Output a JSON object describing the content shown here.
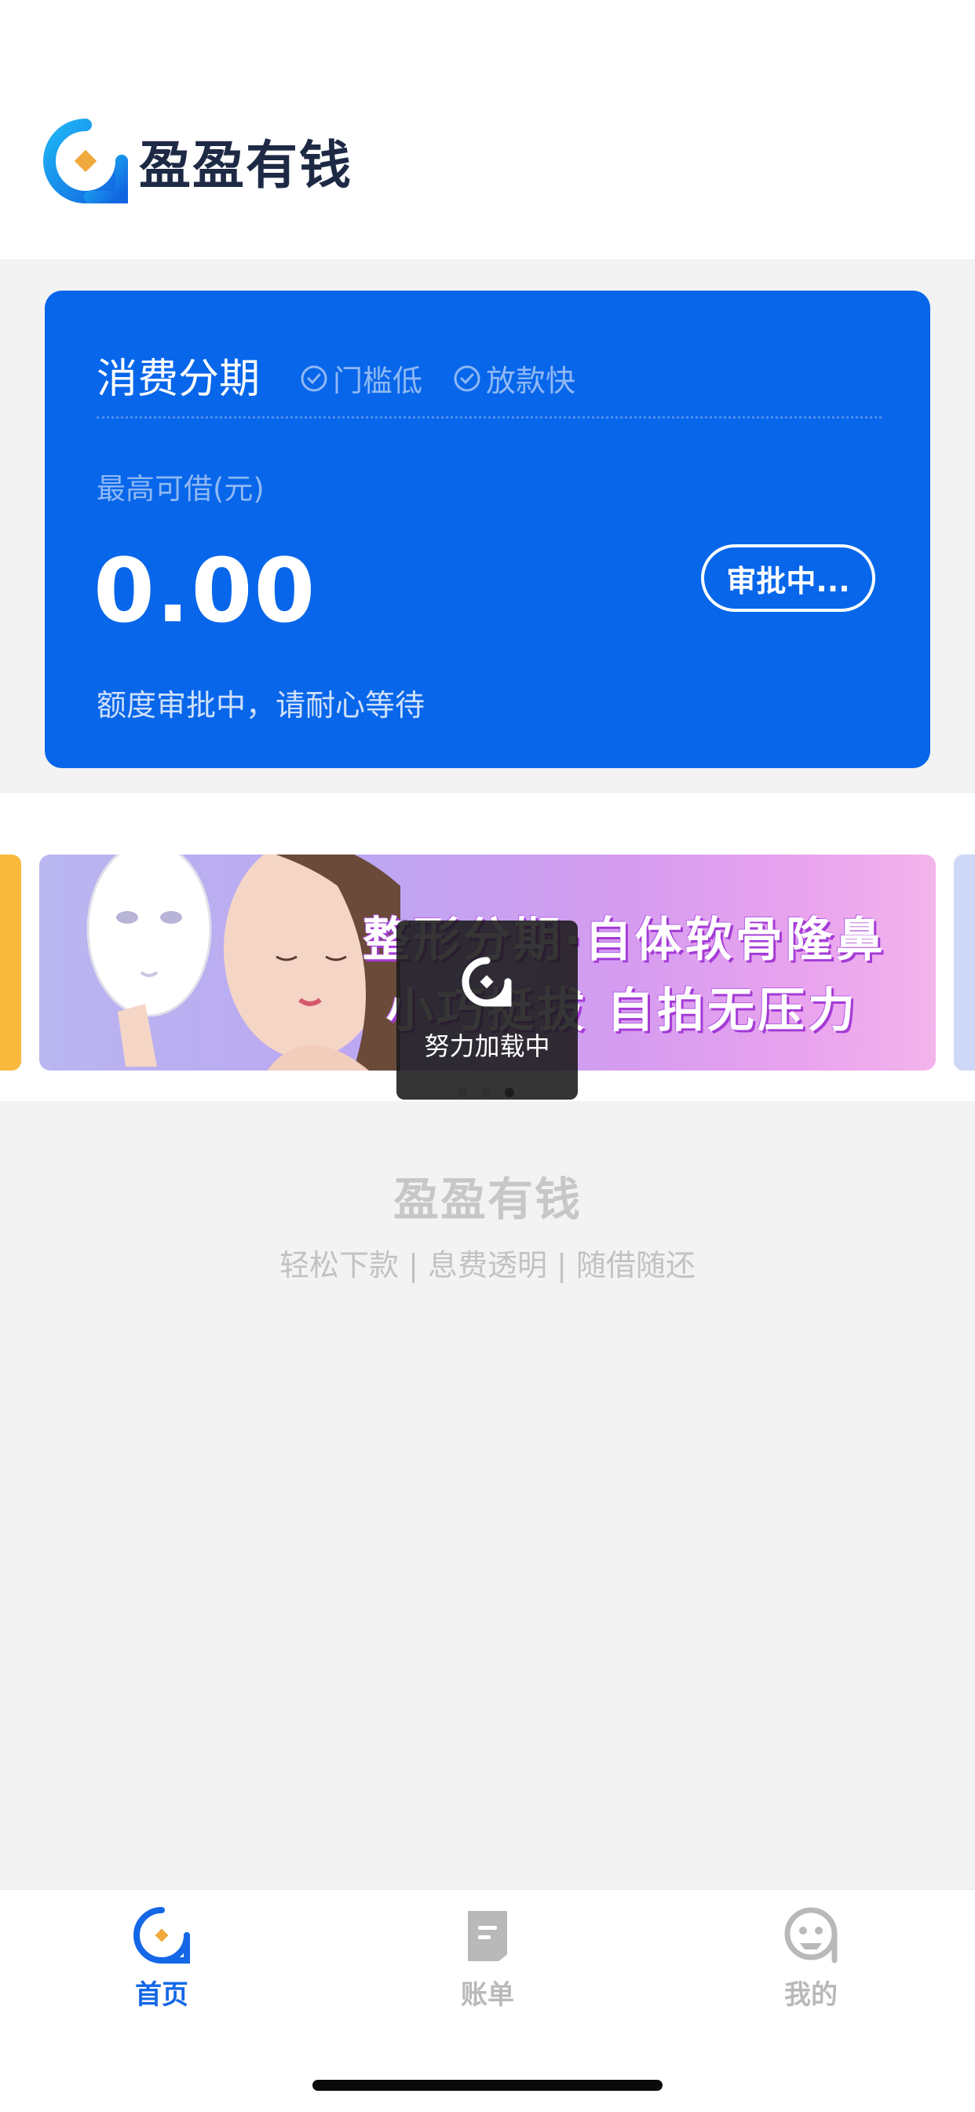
{
  "header": {
    "app_name": "盈盈有钱"
  },
  "loan_card": {
    "title": "消费分期",
    "tags": [
      "门槛低",
      "放款快"
    ],
    "limit_label": "最高可借(元)",
    "amount": "0.00",
    "status_button": "审批中...",
    "note": "额度审批中，请耐心等待"
  },
  "banner": {
    "line1": "整形分期·自体软骨隆鼻",
    "line2": "小巧挺拔 自拍无压力",
    "slide_count": 3,
    "active_index": 2
  },
  "toast": {
    "text": "努力加载中"
  },
  "footer_brand": {
    "name": "盈盈有钱",
    "slogan": "轻松下款 | 息费透明 | 随借随还"
  },
  "tabbar": {
    "items": [
      {
        "label": "首页",
        "icon": "home-icon",
        "active": true
      },
      {
        "label": "账单",
        "icon": "bill-icon",
        "active": false
      },
      {
        "label": "我的",
        "icon": "profile-icon",
        "active": false
      }
    ]
  },
  "colors": {
    "primary": "#0766ea",
    "tab_active": "#1467e6",
    "tab_inactive": "#b9b9b9",
    "logo_accent": "#f0a93c"
  }
}
